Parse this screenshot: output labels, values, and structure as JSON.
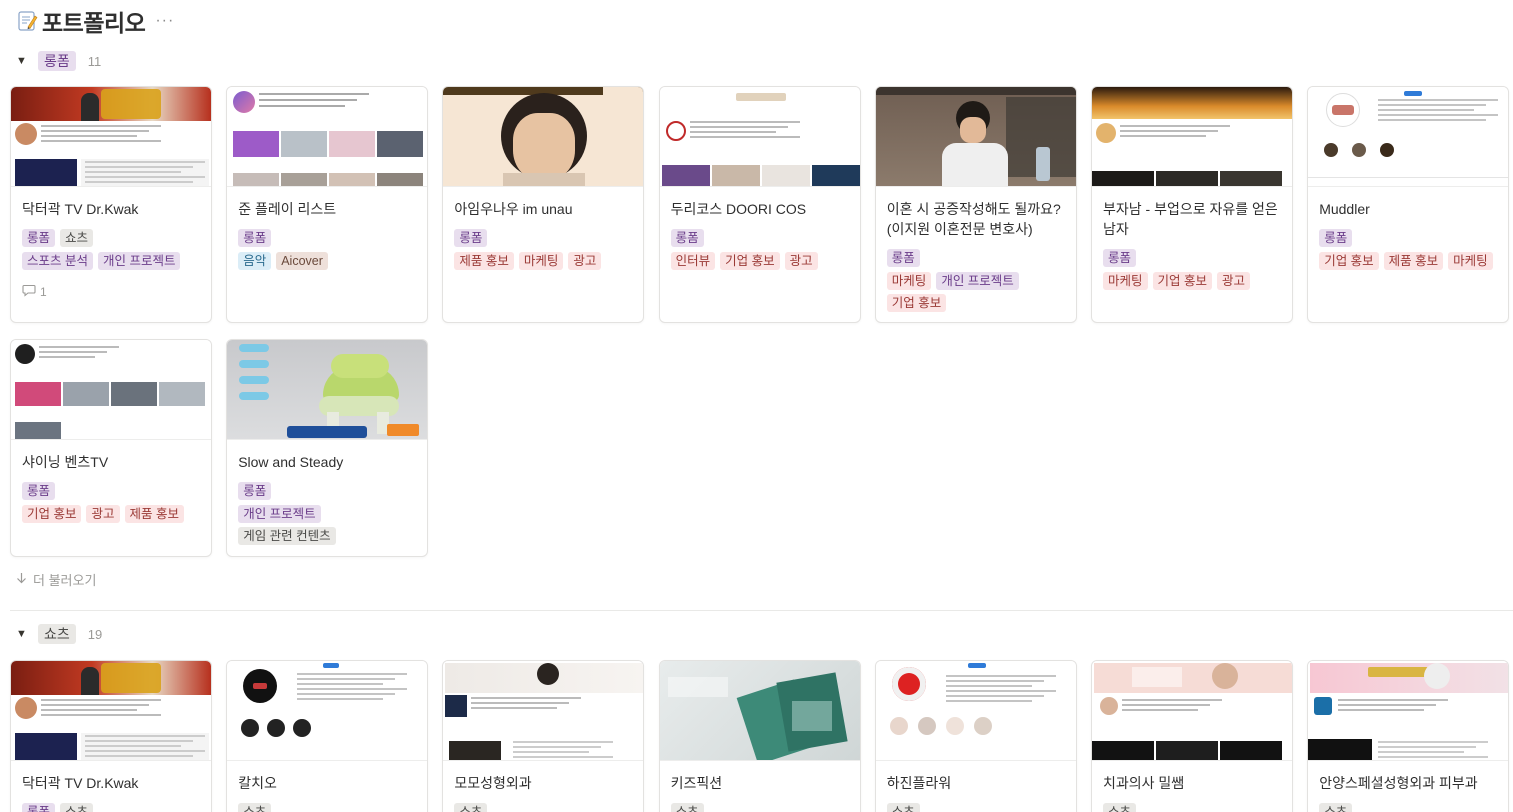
{
  "page": {
    "title": "포트폴리오",
    "icon": "memo-icon",
    "more": "···"
  },
  "colors": {
    "purple_bg": "#e8deee",
    "purple_fg": "#6b3d8a",
    "gray_bg": "#e9e8e5",
    "gray_fg": "#4a4a48",
    "red_bg": "#fbe4e4",
    "red_fg": "#9b3a36",
    "blue_bg": "#dbedf7",
    "blue_fg": "#2a6a8e",
    "brown_bg": "#eee0da",
    "brown_fg": "#6b4a3c"
  },
  "groups": [
    {
      "name": "롱폼",
      "count": "11",
      "tag_color": "purple",
      "cards": [
        {
          "title": "닥터곽 TV Dr.Kwak",
          "thumb": "drkwak",
          "rows": [
            [
              {
                "t": "롱폼",
                "c": "purple"
              },
              {
                "t": "쇼츠",
                "c": "gray"
              }
            ],
            [
              {
                "t": "스포츠 분석",
                "c": "purple"
              },
              {
                "t": "개인 프로젝트",
                "c": "purple"
              }
            ]
          ],
          "comments": "1"
        },
        {
          "title": "준 플레이 리스트",
          "thumb": "playlist",
          "rows": [
            [
              {
                "t": "롱폼",
                "c": "purple"
              }
            ],
            [
              {
                "t": "음악",
                "c": "blue"
              },
              {
                "t": "Aicover",
                "c": "brown"
              }
            ]
          ]
        },
        {
          "title": "아임우나우 im unau",
          "thumb": "unau",
          "rows": [
            [
              {
                "t": "롱폼",
                "c": "purple"
              }
            ],
            [
              {
                "t": "제품 홍보",
                "c": "red"
              },
              {
                "t": "마케팅",
                "c": "red"
              },
              {
                "t": "광고",
                "c": "red"
              }
            ]
          ]
        },
        {
          "title": "두리코스 DOORI COS",
          "thumb": "doori",
          "rows": [
            [
              {
                "t": "롱폼",
                "c": "purple"
              }
            ],
            [
              {
                "t": "인터뷰",
                "c": "red"
              },
              {
                "t": "기업 홍보",
                "c": "red"
              },
              {
                "t": "광고",
                "c": "red"
              }
            ]
          ]
        },
        {
          "title": "이혼 시 공증작성해도 될까요? (이지원 이혼전문 변호사)",
          "thumb": "lawyer",
          "rows": [
            [
              {
                "t": "롱폼",
                "c": "purple"
              }
            ],
            [
              {
                "t": "마케팅",
                "c": "red"
              },
              {
                "t": "개인 프로젝트",
                "c": "purple"
              },
              {
                "t": "기업 홍보",
                "c": "red"
              }
            ]
          ]
        },
        {
          "title": "부자남 - 부업으로 자유를 얻은 남자",
          "thumb": "bujanam",
          "rows": [
            [
              {
                "t": "롱폼",
                "c": "purple"
              }
            ],
            [
              {
                "t": "마케팅",
                "c": "red"
              },
              {
                "t": "기업 홍보",
                "c": "red"
              },
              {
                "t": "광고",
                "c": "red"
              }
            ]
          ]
        },
        {
          "title": "Muddler",
          "thumb": "muddler",
          "rows": [
            [
              {
                "t": "롱폼",
                "c": "purple"
              }
            ],
            [
              {
                "t": "기업 홍보",
                "c": "red"
              },
              {
                "t": "제품 홍보",
                "c": "red"
              },
              {
                "t": "마케팅",
                "c": "red"
              }
            ]
          ]
        },
        {
          "title": "샤이닝 벤츠TV",
          "thumb": "benz",
          "rows": [
            [
              {
                "t": "롱폼",
                "c": "purple"
              }
            ],
            [
              {
                "t": "기업 홍보",
                "c": "red"
              },
              {
                "t": "광고",
                "c": "red"
              },
              {
                "t": "제품 홍보",
                "c": "red"
              }
            ]
          ]
        },
        {
          "title": "Slow and Steady",
          "thumb": "turtle",
          "rows": [
            [
              {
                "t": "롱폼",
                "c": "purple"
              }
            ],
            [
              {
                "t": "개인 프로젝트",
                "c": "purple"
              },
              {
                "t": "게임 관련 컨텐츠",
                "c": "gray"
              }
            ]
          ]
        }
      ],
      "load_more": "더 불러오기"
    },
    {
      "name": "쇼츠",
      "count": "19",
      "tag_color": "gray",
      "cards": [
        {
          "title": "닥터곽 TV Dr.Kwak",
          "thumb": "drkwak",
          "rows": [
            [
              {
                "t": "롱폼",
                "c": "purple"
              },
              {
                "t": "쇼츠",
                "c": "gray"
              }
            ]
          ]
        },
        {
          "title": "칼치오",
          "thumb": "calcio",
          "rows": [
            [
              {
                "t": "쇼츠",
                "c": "gray"
              }
            ]
          ]
        },
        {
          "title": "모모성형외과",
          "thumb": "momo",
          "rows": [
            [
              {
                "t": "쇼츠",
                "c": "gray"
              }
            ]
          ]
        },
        {
          "title": "키즈픽션",
          "thumb": "kidsfiction",
          "rows": [
            [
              {
                "t": "쇼츠",
                "c": "gray"
              }
            ]
          ]
        },
        {
          "title": "하진플라워",
          "thumb": "flower",
          "rows": [
            [
              {
                "t": "쇼츠",
                "c": "gray"
              }
            ]
          ]
        },
        {
          "title": "치과의사 밀쌤",
          "thumb": "dentist",
          "rows": [
            [
              {
                "t": "쇼츠",
                "c": "gray"
              }
            ]
          ]
        },
        {
          "title": "안양스페셜성형외과 피부과",
          "thumb": "anyang",
          "rows": [
            [
              {
                "t": "쇼츠",
                "c": "gray"
              }
            ]
          ]
        }
      ]
    }
  ]
}
